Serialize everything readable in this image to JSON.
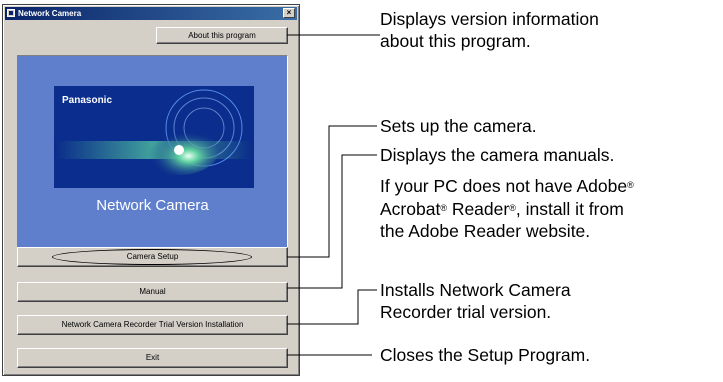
{
  "window": {
    "title": "Network Camera",
    "close_glyph": "×"
  },
  "buttons": {
    "about": "About this program",
    "camera_setup": "Camera Setup",
    "manual": "Manual",
    "recorder": "Network Camera Recorder Trial Version Installation",
    "exit": "Exit"
  },
  "splash": {
    "brand": "Panasonic",
    "product": "Network Camera"
  },
  "callouts": {
    "about_1": "Displays version information",
    "about_2": "about this program.",
    "setup": "Sets up the camera.",
    "manual": "Displays the camera manuals.",
    "adobe_1a": "If your PC does not have Adobe",
    "adobe_2a": "Acrobat",
    "adobe_2b": " Reader",
    "adobe_2c": ", install it from",
    "adobe_3": "the Adobe Reader website.",
    "reg": "®",
    "recorder_1": "Installs Network Camera",
    "recorder_2": "Recorder trial version.",
    "exit": "Closes the Setup Program."
  },
  "colors": {
    "dialog_bg": "#d4d0c8",
    "titlebar": "#0a246a",
    "splash_bg": "#5f7fcd",
    "art_bg": "#0a2a88"
  }
}
